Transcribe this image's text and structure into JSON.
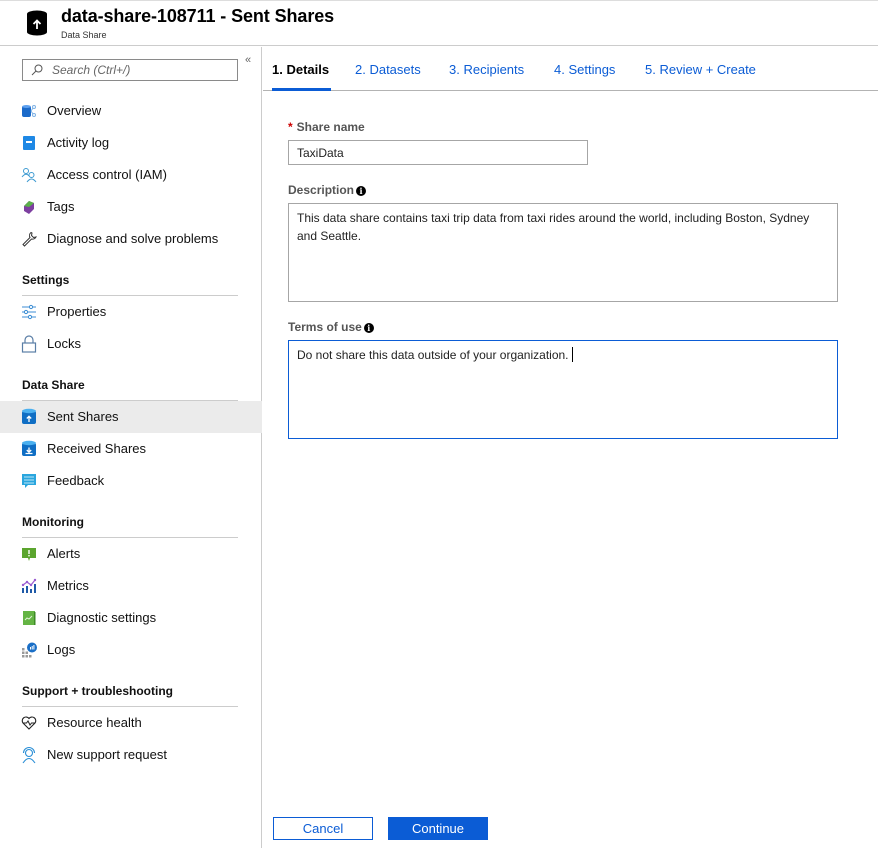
{
  "header": {
    "title": "data-share-108711 - Sent Shares",
    "subtitle": "Data Share",
    "icon": "data-share-upload-icon"
  },
  "sidebar": {
    "search_placeholder": "Search (Ctrl+/)",
    "collapse_label": "«",
    "items_top": [
      {
        "label": "Overview",
        "icon": "overview-icon"
      },
      {
        "label": "Activity log",
        "icon": "activity-log-icon"
      },
      {
        "label": "Access control (IAM)",
        "icon": "access-control-icon"
      },
      {
        "label": "Tags",
        "icon": "tag-icon"
      },
      {
        "label": "Diagnose and solve problems",
        "icon": "wrench-icon"
      }
    ],
    "sections": [
      {
        "title": "Settings",
        "items": [
          {
            "label": "Properties",
            "icon": "properties-icon"
          },
          {
            "label": "Locks",
            "icon": "lock-icon"
          }
        ]
      },
      {
        "title": "Data Share",
        "items": [
          {
            "label": "Sent Shares",
            "icon": "sent-shares-icon",
            "active": true
          },
          {
            "label": "Received Shares",
            "icon": "received-shares-icon"
          },
          {
            "label": "Feedback",
            "icon": "feedback-icon"
          }
        ]
      },
      {
        "title": "Monitoring",
        "items": [
          {
            "label": "Alerts",
            "icon": "alerts-icon"
          },
          {
            "label": "Metrics",
            "icon": "metrics-icon"
          },
          {
            "label": "Diagnostic settings",
            "icon": "diagnostic-settings-icon"
          },
          {
            "label": "Logs",
            "icon": "logs-icon"
          }
        ]
      },
      {
        "title": "Support + troubleshooting",
        "items": [
          {
            "label": "Resource health",
            "icon": "heart-icon"
          },
          {
            "label": "New support request",
            "icon": "support-request-icon"
          }
        ]
      }
    ]
  },
  "tabs": [
    {
      "label": "1. Details",
      "active": true
    },
    {
      "label": "2. Datasets"
    },
    {
      "label": "3. Recipients"
    },
    {
      "label": "4. Settings"
    },
    {
      "label": "5. Review + Create"
    }
  ],
  "form": {
    "share_name": {
      "label": "Share name",
      "required_mark": "*",
      "value": "TaxiData"
    },
    "description": {
      "label": "Description",
      "info": "i",
      "value": "This data share contains taxi trip data from taxi rides around the world, including Boston, Sydney and Seattle."
    },
    "terms": {
      "label": "Terms of use",
      "info": "i",
      "value": "Do not share this data outside of your organization."
    }
  },
  "buttons": {
    "cancel": "Cancel",
    "continue": "Continue"
  },
  "colors": {
    "accent": "#0b5cd5",
    "active_nav_bg": "#ebebeb",
    "required": "#cc0000"
  }
}
